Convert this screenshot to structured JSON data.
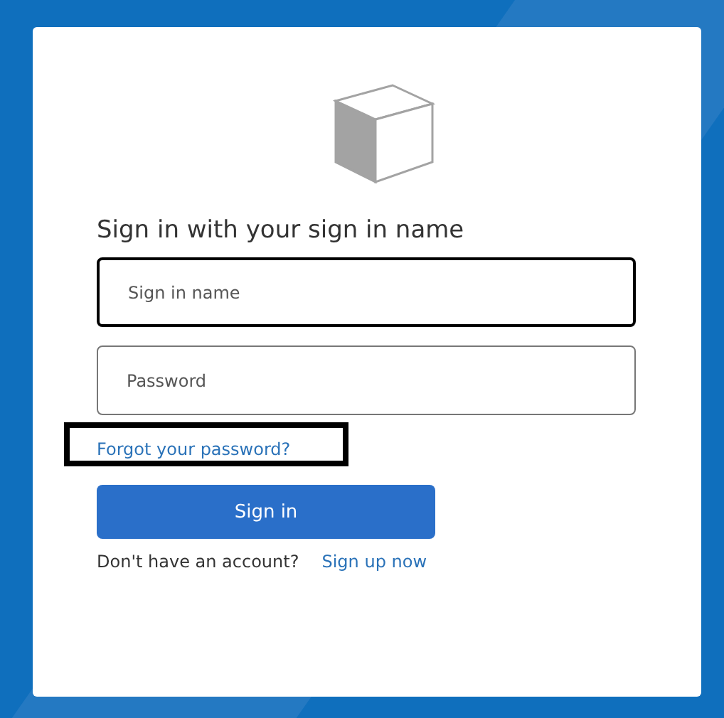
{
  "heading": "Sign in with your sign in name",
  "fields": [
    {
      "placeholder": "Sign in name",
      "focused": true
    },
    {
      "placeholder": "Password",
      "focused": false
    }
  ],
  "forgot_link": {
    "label": "Forgot your password?",
    "highlighted": true
  },
  "submit_button": {
    "label": "Sign in"
  },
  "signup": {
    "prompt": "Don't have an account?",
    "link": "Sign up now"
  }
}
